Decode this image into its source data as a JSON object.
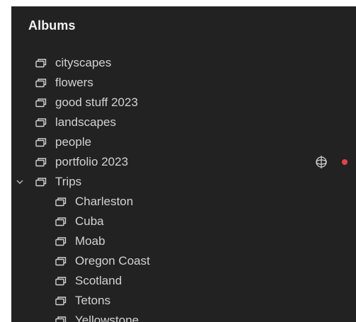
{
  "panel": {
    "title": "Albums"
  },
  "albums": [
    {
      "label": "cityscapes"
    },
    {
      "label": "flowers"
    },
    {
      "label": "good stuff 2023"
    },
    {
      "label": "landscapes"
    },
    {
      "label": "people"
    },
    {
      "label": "portfolio 2023",
      "has_sync_icon": true,
      "has_status_dot": true
    }
  ],
  "trips": {
    "label": "Trips",
    "expanded": true,
    "children": [
      {
        "label": "Charleston"
      },
      {
        "label": "Cuba"
      },
      {
        "label": "Moab"
      },
      {
        "label": "Oregon Coast"
      },
      {
        "label": "Scotland"
      },
      {
        "label": "Tetons"
      },
      {
        "label": "Yellowstone"
      }
    ]
  },
  "icons": {
    "album": "album-stack-icon",
    "expand": "chevron-down-icon",
    "sync": "sync-globe-icon",
    "status": "status-dot-icon"
  },
  "colors": {
    "panel_bg": "#222222",
    "text": "#d2d2d2",
    "title": "#f2f2f2",
    "status_dot": "#e8404a"
  }
}
